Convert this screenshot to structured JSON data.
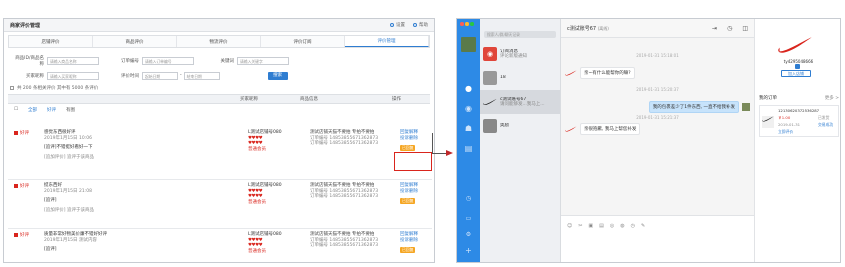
{
  "left": {
    "title": "商家评价管理",
    "header_links": [
      "设置",
      "帮助"
    ],
    "tabs": [
      "店铺评价",
      "商品评价",
      "物流评价",
      "评价订阅",
      "评价管理"
    ],
    "active_tab": 4,
    "filters": {
      "row1": [
        {
          "label": "商品ID/商品名称",
          "placeholder": "请输入商品名称"
        },
        {
          "label": "订单编号",
          "placeholder": "请输入订单编号"
        },
        {
          "label": "关键词",
          "placeholder": "请输入关键字"
        }
      ],
      "row2_label1": "买家昵称",
      "row2_placeholder1": "请输入买家昵称",
      "row2_label2": "评价时间",
      "date_start": "起始日期",
      "date_sep": "-",
      "date_end": "结束日期",
      "query_button": "搜索"
    },
    "stat_text": "共 200 条相关评价 其中有 5000 条评价",
    "columns": [
      "",
      "买家昵称",
      "商品信息",
      "操作"
    ],
    "toolbar": [
      "全部",
      "好评",
      "有图"
    ],
    "rows": [
      {
        "tag": "好评",
        "line1": "感觉东西很好评",
        "line2": "2019年1月15日 10:06",
        "line3": "[追评]不错挺好看好一下",
        "line4": "[追加评价] 追评于该商品",
        "buyer": "L测试店铺号080",
        "buyer_level": "普通会员",
        "product": "测试店铺天猫不要拍 专拍不要拍",
        "prod2": "订单编号 14853855671362873",
        "prod3": "订单编号 14853855671362873",
        "actions": [
          "回复解释",
          "投诉删除",
          "已回复"
        ],
        "badge": "已回复"
      },
      {
        "tag": "好评",
        "line1": "挺东西好",
        "line2": "2019年1月15日 21:08",
        "line3": "[追评]",
        "line4": "[追加评价] 追评于该商品",
        "buyer": "L测试店铺号080",
        "buyer_level": "普通会员",
        "product": "测试店铺天猫不要拍 专拍不要拍",
        "prod2": "订单编号 14853855671362873",
        "prod3": "订单编号 14853855671362873",
        "actions": [
          "回复解释",
          "投诉删除",
          "已回复"
        ],
        "badge": "已回复"
      },
      {
        "tag": "好评",
        "line1": "质量非常好物美价廉不错好好评",
        "line2": "2019年1月15日 测试内容",
        "line3": "[追评]",
        "line4": "",
        "buyer": "L测试店铺号080",
        "buyer_level": "普通会员",
        "product": "测试店铺天猫不要拍 专拍不要拍",
        "prod2": "订单编号 14853855671362873",
        "prod3": "订单编号 14853855671362873",
        "actions": [
          "回复解释",
          "投诉删除",
          "已回复"
        ],
        "badge": "已回复"
      }
    ]
  },
  "right": {
    "search_placeholder": "搜索人/群/聊天记录",
    "contacts": [
      {
        "name": "订阅消息",
        "sub": "评论新版通知"
      },
      {
        "name": "18",
        "sub": ""
      },
      {
        "name": "c测试账号67",
        "sub": "请问能够发...我马上..."
      },
      {
        "name": "奥励",
        "sub": ""
      }
    ],
    "chat_title": "c测试账号67",
    "chat_status": "(离线)",
    "messages": [
      {
        "time": "2019-01-31 15:18:01",
        "text": "亲~有什么能帮你的嘛?",
        "from": "them"
      },
      {
        "time": "2019-01-31 15:20:37",
        "text": "我的包裹差少了1件东西, 一直不给我补发",
        "from": "me"
      },
      {
        "time": "2019-01-31 15:21:37",
        "text": "亲很抱歉, 我马上帮您补发",
        "from": "them"
      }
    ],
    "info": {
      "name": "ty4295048666",
      "add_button": "加入店铺",
      "order_header": "我的订单",
      "more": "更多 >",
      "order_no": "12130620372536287",
      "price": "￥1.00",
      "price_label": "已发货",
      "order_date": "2019-01-31",
      "order_action": "立即评价",
      "order_status": "交易成功"
    }
  }
}
